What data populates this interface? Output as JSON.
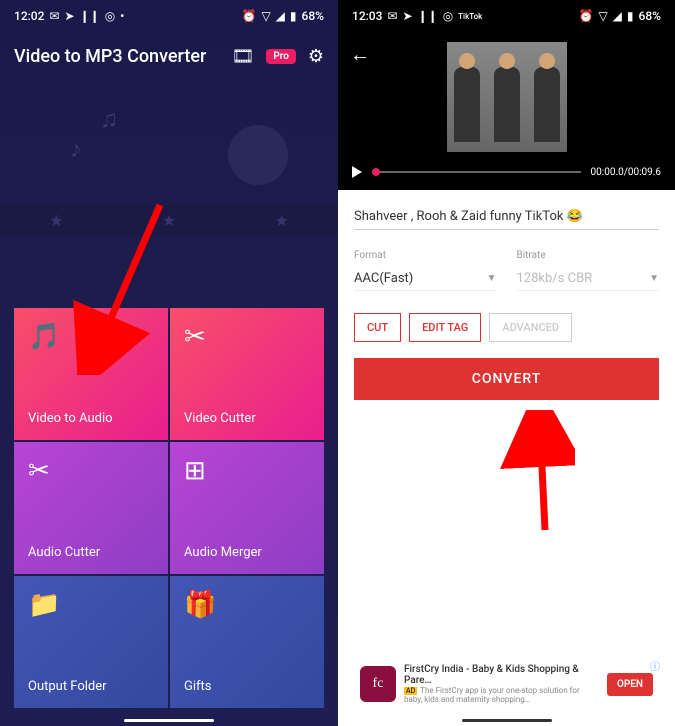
{
  "left": {
    "status": {
      "time": "12:02",
      "battery": "68%"
    },
    "app_title": "Video to MP3 Converter",
    "pro": "Pro",
    "tiles": {
      "video_to_audio": "Video to Audio",
      "video_cutter": "Video Cutter",
      "audio_cutter": "Audio Cutter",
      "audio_merger": "Audio Merger",
      "output_folder": "Output Folder",
      "gifts": "Gifts"
    }
  },
  "right": {
    "status": {
      "time": "12:03",
      "app_sub": "TikTok",
      "battery": "68%"
    },
    "player": {
      "time": "00:00.0/00:09.6"
    },
    "title_input": "Shahveer , Rooh & Zaid funny TikTok 😂",
    "format_label": "Format",
    "format_value": "AAC(Fast)",
    "bitrate_label": "Bitrate",
    "bitrate_value": "128kb/s CBR",
    "actions": {
      "cut": "CUT",
      "edit_tag": "EDIT TAG",
      "advanced": "ADVANCED"
    },
    "convert": "CONVERT",
    "ad": {
      "icon": "fc",
      "title": "FirstCry India - Baby & Kids Shopping & Pare…",
      "badge": "AD",
      "sub": "The FirstCry app is your one-stop solution for baby, kids and maternity shopping…",
      "open": "OPEN"
    }
  }
}
